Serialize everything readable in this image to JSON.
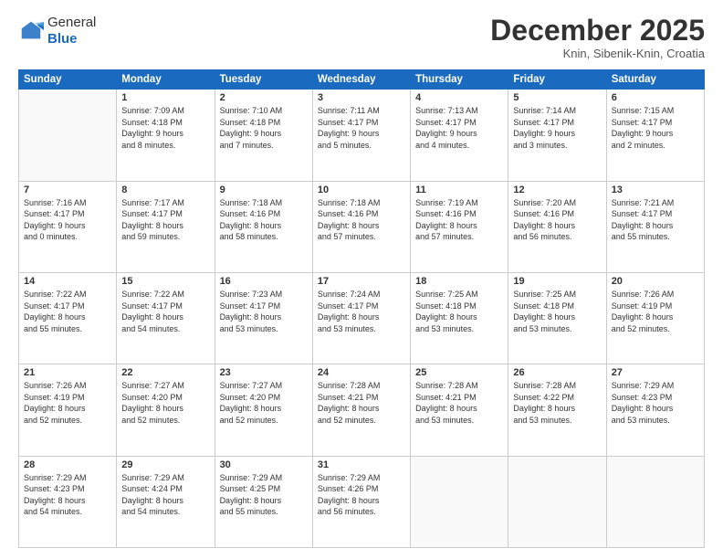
{
  "logo": {
    "general": "General",
    "blue": "Blue"
  },
  "header": {
    "month": "December 2025",
    "location": "Knin, Sibenik-Knin, Croatia"
  },
  "days_of_week": [
    "Sunday",
    "Monday",
    "Tuesday",
    "Wednesday",
    "Thursday",
    "Friday",
    "Saturday"
  ],
  "weeks": [
    [
      {
        "day": "",
        "info": ""
      },
      {
        "day": "1",
        "info": "Sunrise: 7:09 AM\nSunset: 4:18 PM\nDaylight: 9 hours\nand 8 minutes."
      },
      {
        "day": "2",
        "info": "Sunrise: 7:10 AM\nSunset: 4:18 PM\nDaylight: 9 hours\nand 7 minutes."
      },
      {
        "day": "3",
        "info": "Sunrise: 7:11 AM\nSunset: 4:17 PM\nDaylight: 9 hours\nand 5 minutes."
      },
      {
        "day": "4",
        "info": "Sunrise: 7:13 AM\nSunset: 4:17 PM\nDaylight: 9 hours\nand 4 minutes."
      },
      {
        "day": "5",
        "info": "Sunrise: 7:14 AM\nSunset: 4:17 PM\nDaylight: 9 hours\nand 3 minutes."
      },
      {
        "day": "6",
        "info": "Sunrise: 7:15 AM\nSunset: 4:17 PM\nDaylight: 9 hours\nand 2 minutes."
      }
    ],
    [
      {
        "day": "7",
        "info": "Sunrise: 7:16 AM\nSunset: 4:17 PM\nDaylight: 9 hours\nand 0 minutes."
      },
      {
        "day": "8",
        "info": "Sunrise: 7:17 AM\nSunset: 4:17 PM\nDaylight: 8 hours\nand 59 minutes."
      },
      {
        "day": "9",
        "info": "Sunrise: 7:18 AM\nSunset: 4:16 PM\nDaylight: 8 hours\nand 58 minutes."
      },
      {
        "day": "10",
        "info": "Sunrise: 7:18 AM\nSunset: 4:16 PM\nDaylight: 8 hours\nand 57 minutes."
      },
      {
        "day": "11",
        "info": "Sunrise: 7:19 AM\nSunset: 4:16 PM\nDaylight: 8 hours\nand 57 minutes."
      },
      {
        "day": "12",
        "info": "Sunrise: 7:20 AM\nSunset: 4:16 PM\nDaylight: 8 hours\nand 56 minutes."
      },
      {
        "day": "13",
        "info": "Sunrise: 7:21 AM\nSunset: 4:17 PM\nDaylight: 8 hours\nand 55 minutes."
      }
    ],
    [
      {
        "day": "14",
        "info": "Sunrise: 7:22 AM\nSunset: 4:17 PM\nDaylight: 8 hours\nand 55 minutes."
      },
      {
        "day": "15",
        "info": "Sunrise: 7:22 AM\nSunset: 4:17 PM\nDaylight: 8 hours\nand 54 minutes."
      },
      {
        "day": "16",
        "info": "Sunrise: 7:23 AM\nSunset: 4:17 PM\nDaylight: 8 hours\nand 53 minutes."
      },
      {
        "day": "17",
        "info": "Sunrise: 7:24 AM\nSunset: 4:17 PM\nDaylight: 8 hours\nand 53 minutes."
      },
      {
        "day": "18",
        "info": "Sunrise: 7:25 AM\nSunset: 4:18 PM\nDaylight: 8 hours\nand 53 minutes."
      },
      {
        "day": "19",
        "info": "Sunrise: 7:25 AM\nSunset: 4:18 PM\nDaylight: 8 hours\nand 53 minutes."
      },
      {
        "day": "20",
        "info": "Sunrise: 7:26 AM\nSunset: 4:19 PM\nDaylight: 8 hours\nand 52 minutes."
      }
    ],
    [
      {
        "day": "21",
        "info": "Sunrise: 7:26 AM\nSunset: 4:19 PM\nDaylight: 8 hours\nand 52 minutes."
      },
      {
        "day": "22",
        "info": "Sunrise: 7:27 AM\nSunset: 4:20 PM\nDaylight: 8 hours\nand 52 minutes."
      },
      {
        "day": "23",
        "info": "Sunrise: 7:27 AM\nSunset: 4:20 PM\nDaylight: 8 hours\nand 52 minutes."
      },
      {
        "day": "24",
        "info": "Sunrise: 7:28 AM\nSunset: 4:21 PM\nDaylight: 8 hours\nand 52 minutes."
      },
      {
        "day": "25",
        "info": "Sunrise: 7:28 AM\nSunset: 4:21 PM\nDaylight: 8 hours\nand 53 minutes."
      },
      {
        "day": "26",
        "info": "Sunrise: 7:28 AM\nSunset: 4:22 PM\nDaylight: 8 hours\nand 53 minutes."
      },
      {
        "day": "27",
        "info": "Sunrise: 7:29 AM\nSunset: 4:23 PM\nDaylight: 8 hours\nand 53 minutes."
      }
    ],
    [
      {
        "day": "28",
        "info": "Sunrise: 7:29 AM\nSunset: 4:23 PM\nDaylight: 8 hours\nand 54 minutes."
      },
      {
        "day": "29",
        "info": "Sunrise: 7:29 AM\nSunset: 4:24 PM\nDaylight: 8 hours\nand 54 minutes."
      },
      {
        "day": "30",
        "info": "Sunrise: 7:29 AM\nSunset: 4:25 PM\nDaylight: 8 hours\nand 55 minutes."
      },
      {
        "day": "31",
        "info": "Sunrise: 7:29 AM\nSunset: 4:26 PM\nDaylight: 8 hours\nand 56 minutes."
      },
      {
        "day": "",
        "info": ""
      },
      {
        "day": "",
        "info": ""
      },
      {
        "day": "",
        "info": ""
      }
    ]
  ]
}
